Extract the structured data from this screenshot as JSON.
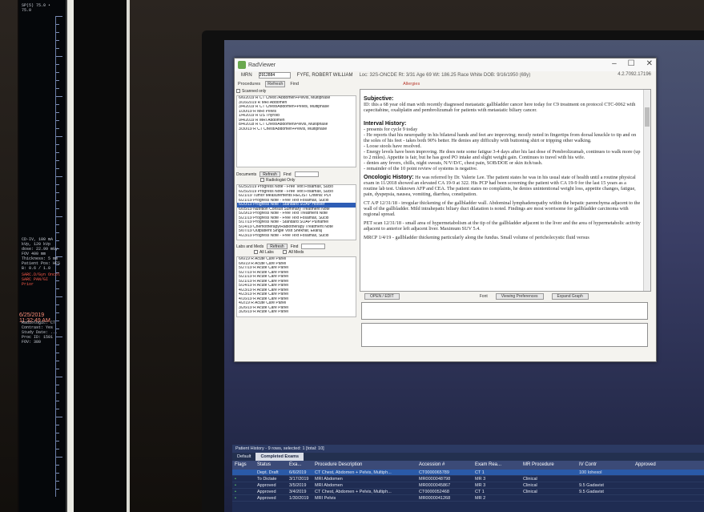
{
  "left_monitor": {
    "top_text": "SP(5) 75.0 • 75.0",
    "mid_lines": [
      "CD-IV, 100 mA",
      "kVp, 120 kVp",
      "dose: 22.99 mGy",
      "FOV 400 mm",
      "Thickness: 5 mm",
      "Patient Pos: HFS",
      "B: 0.6 / 1.0"
    ],
    "lower_lines": [
      "SARC.D/Gyn Oncol",
      "SARC PAN/GI",
      "Prior"
    ],
    "date_line": "6/25/2019 11:32:49 AM",
    "after_date_lines": [
      "Radiologic: CT",
      "Contrast: Yes",
      "Study Date: ...",
      "Proc ID: 1501",
      "FOV: 380"
    ]
  },
  "window": {
    "title": "RadViewer",
    "controls": [
      "–",
      "☐",
      "✕"
    ],
    "mrn_label": "MRN",
    "mrn_value": "2912884",
    "patient_name": "FYFE, ROBERT WILLIAM",
    "patient_meta": "Loc: 32S-ONCDE  Rt: 3/31  Age 69  Wt: 186.25  Race White  DOB: 9/16/1950 (69y)",
    "version": "4.2.7092.17196",
    "procedures_label": "Procedures",
    "refresh_label": "Refresh",
    "find_label": "Find",
    "scanned_only_label": "Scanned only",
    "allergies_label": "Allergies",
    "procedures": [
      "6/6/2019 R CT Chest /Abdomen+Pelvis, Multiphase",
      "3/16/2019 R MRI Abdomen",
      "3/4/2019 R CT Chest/Abdomen+Pelvis, Multiphase",
      "1/30/19 R MRI Pelvis",
      "1/4/2019 R US Thyroid",
      "9/4/2019 R MRI Abdomen",
      "8/4/2018 R CT Chest/Abdomen/Pelvis, Multiphase",
      "3/30/19 R CT Chest/Abdomen+Pelvis, Multiphase"
    ],
    "documents_label": "Documents",
    "refresh2_label": "Refresh",
    "find2_label": "Find",
    "radiologist_only_label": "Radiologist Only",
    "documents": [
      "6/25/2019 Progress Note - Free Text  Fosamax, Sucio",
      "6/25/2019 Progress Note - Free Text  Fosamax, Sucio",
      "6/21/19 Tumor Measurements RECIST Criteria: PDI",
      "6/21/19 Progress Note - Free Text  Fosamax, Sucio",
      "6/20/19 Progress Note - Standard SOAP  Hoover",
      "6/05/19 Nutrition Consult Summary  Treatment Note",
      "5/29/19 Progress Note - Free Text  Treatment Note",
      "5/21/19 Progress Note - Free Text  Fosamax, Sucio",
      "5/17/19 Progress Note - Standard SOAP  Pulhamel",
      "5/14/19 Chemotherapy/Radiotherapy Treatment Note",
      "5/07/19 Outpatient Single Visit  Shekhar, Ekaraj",
      "4/23/19 Progress Note - Free Text  Fosamax, Sucio"
    ],
    "selected_document_index": 4,
    "labs_label": "Labs and Meds",
    "refresh3_label": "Refresh",
    "find3_label": "Find",
    "all_labs_label": "All Labs",
    "all_meds_label": "All Meds",
    "labs": [
      "6/6/19 R Acute Care Panel",
      "6/6/19 R Acute Care Panel",
      "5/27/19 R Acute Care Panel",
      "5/27/19 R Acute Care Panel",
      "5/21/19 R Acute Care Panel",
      "5/21/19 R Acute Care Panel",
      "5/14/19 R Acute Care Panel",
      "4/23/19 R Acute Care Panel",
      "4/23/19 R Acute Care Panel",
      "4/16/19 R Acute Care Panel",
      "4/2/19 R Acute Care Panel",
      "3/26/19 R Acute Care Panel",
      "3/26/19 R Acute Care Panel"
    ],
    "note": {
      "subjective_heading": "Subjective:",
      "subjective_text": "ID: this a 68 year old man with recently diagnosed metastatic gallbladder cancer here today for C9 treatment on protocol CTC-0062 with capecitabine, oxaliplatin and pembrolizumab for patients with metastatic biliary cancer.",
      "interval_heading": "Interval History:",
      "interval_lines": [
        "- presents for cycle 9 today",
        "- He reports that his neuropathy in his bilateral hands and feet are improving; mostly noted in fingertips from dorsal knuckle to tip and on the soles of his feet - takes both 90% better. He denies any difficulty with buttoning shirt or tripping other walking.",
        "- Loose stools have resolved.",
        "- Energy levels have been improving. He does note some fatigue 3-4 days after his last dose of Pembrolizumab, continues to walk more (up to 2 miles). Appetite is fair, but he has good PO intake and slight weight gain. Continues to travel with his wife.",
        "- denies any fevers, chills, night sweats, N/V/D/C, chest pain, SOB/DOE or skin itch/rash.",
        "- remainder of the 10 point review of systems is negative."
      ],
      "oncologic_heading": "Oncologic History:",
      "oncologic_text": "He was referred by Dr. Valerie Lee. The patient states he was in his usual state of health until a routine physical exam in 11/2018 showed an elevated CA 19-9 at 322. His PCP had been screening the patient with CA 19-9 for the last 15 years as a routine lab test. Unknown AFP and CEA. The patient states no complaints, he denies unintentional weight loss, appetite changes, fatigue, pain, dyspepsia, nausea, vomiting, diarrhea, constipation.",
      "ct_text": "CT A/P 12/31/18 - irregular thickening of the gallbladder wall. Abdominal lymphadenopathy within the hepatic parenchyma adjacent to the wall of the gallbladder. Mild intrahepatic biliary duct dilatation is noted. Findings are most worrisome for gallbladder carcinoma with regional spread.",
      "pet_text": "PET scan 12/31/18 - small area of hypermetabolism at the tip of the gallbladder adjacent to the liver and the area of hypermetabolic activity adjacent to anterior left adjacent liver. Maximum SUV 5.4.",
      "mrcp_text": "MRCP 1/4/19 - gallbladder thickening particularly along the fundus. Small volume of pericholecystic fluid versus"
    },
    "bottom_strip": {
      "open_label": "OPEN / EDIT",
      "font_label": "Font",
      "viewing_label": "Viewing Preferences",
      "expand_label": "Expand Graph"
    }
  },
  "history": {
    "title": "Patient History - 9 rows, selected: 1 [total: 10]",
    "tabs": [
      "Default",
      "Completed Exams"
    ],
    "active_tab": "Completed Exams",
    "columns": [
      "Flags",
      "Status",
      "Exa...",
      "Procedure Description",
      "Accession #",
      "Exam Rea...",
      "MR Procedure",
      "IV Contr",
      "Approved"
    ],
    "rows": [
      [
        "",
        "Dept. Draft",
        "6/6/2019",
        "CT Chest, Abdomen + Pelvis, Multiph...",
        "CT0000065789",
        "CT 1",
        "",
        "100 Iohexol",
        ""
      ],
      [
        "•",
        "To Dictate",
        "3/17/2019",
        "MRI Abdomen",
        "MR0000048798",
        "MR 3",
        "Clinical",
        "",
        ""
      ],
      [
        "•",
        "Approved",
        "3/5/2019",
        "MRI Abdomen",
        "MR0000045867",
        "MR 3",
        "Clinical",
        "9.5 Gadavist",
        ""
      ],
      [
        "•",
        "Approved",
        "3/4/2019",
        "CT Chest, Abdomen + Pelvis, Multiph...",
        "CT0000052468",
        "CT 1",
        "Clinical",
        "9.5 Gadavist",
        ""
      ],
      [
        "•",
        "Approved",
        "1/30/2019",
        "MRI Pelvis",
        "MR0000041268",
        "MR 2",
        "",
        "",
        ""
      ]
    ]
  },
  "colors": {
    "selection": "#2e5db5",
    "history_bg": "#1f2c52",
    "status_green": "#69d86a",
    "warning_red": "#b83a2e"
  }
}
